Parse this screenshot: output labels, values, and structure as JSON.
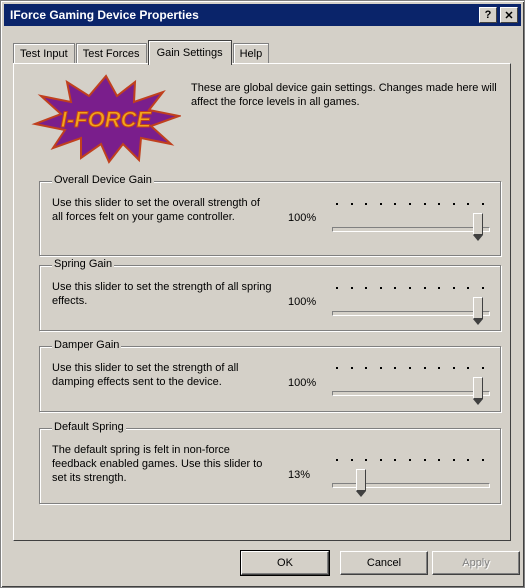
{
  "window": {
    "title": "IForce Gaming Device Properties",
    "help_btn": "?",
    "close_btn": "✕"
  },
  "tabs": [
    {
      "label": "Test Input",
      "active": false
    },
    {
      "label": "Test Forces",
      "active": false
    },
    {
      "label": "Gain Settings",
      "active": true
    },
    {
      "label": "Help",
      "active": false
    }
  ],
  "logo": {
    "text": "I-FORCE",
    "colors": {
      "burst": "#7a1e8c",
      "text": "#f2a51a",
      "outline": "#c0401e"
    }
  },
  "intro": "These are global device gain settings.  Changes made here will affect the force levels in all games.",
  "groups": [
    {
      "title": "Overall Device Gain",
      "description": "Use this slider to set the overall strength of all forces felt on your game controller.",
      "value": "100%",
      "level": 1.0
    },
    {
      "title": "Spring Gain",
      "description": "Use this slider to set the strength of all spring effects.",
      "value": "100%",
      "level": 1.0
    },
    {
      "title": "Damper Gain",
      "description": "Use this slider to set the strength of all damping effects sent to the device.",
      "value": "100%",
      "level": 1.0
    },
    {
      "title": "Default Spring",
      "description": "The default spring is felt in non-force feedback enabled games. Use this slider to set its strength.",
      "value": "13%",
      "level": 0.13
    }
  ],
  "buttons": {
    "ok": "OK",
    "cancel": "Cancel",
    "apply": "Apply"
  }
}
